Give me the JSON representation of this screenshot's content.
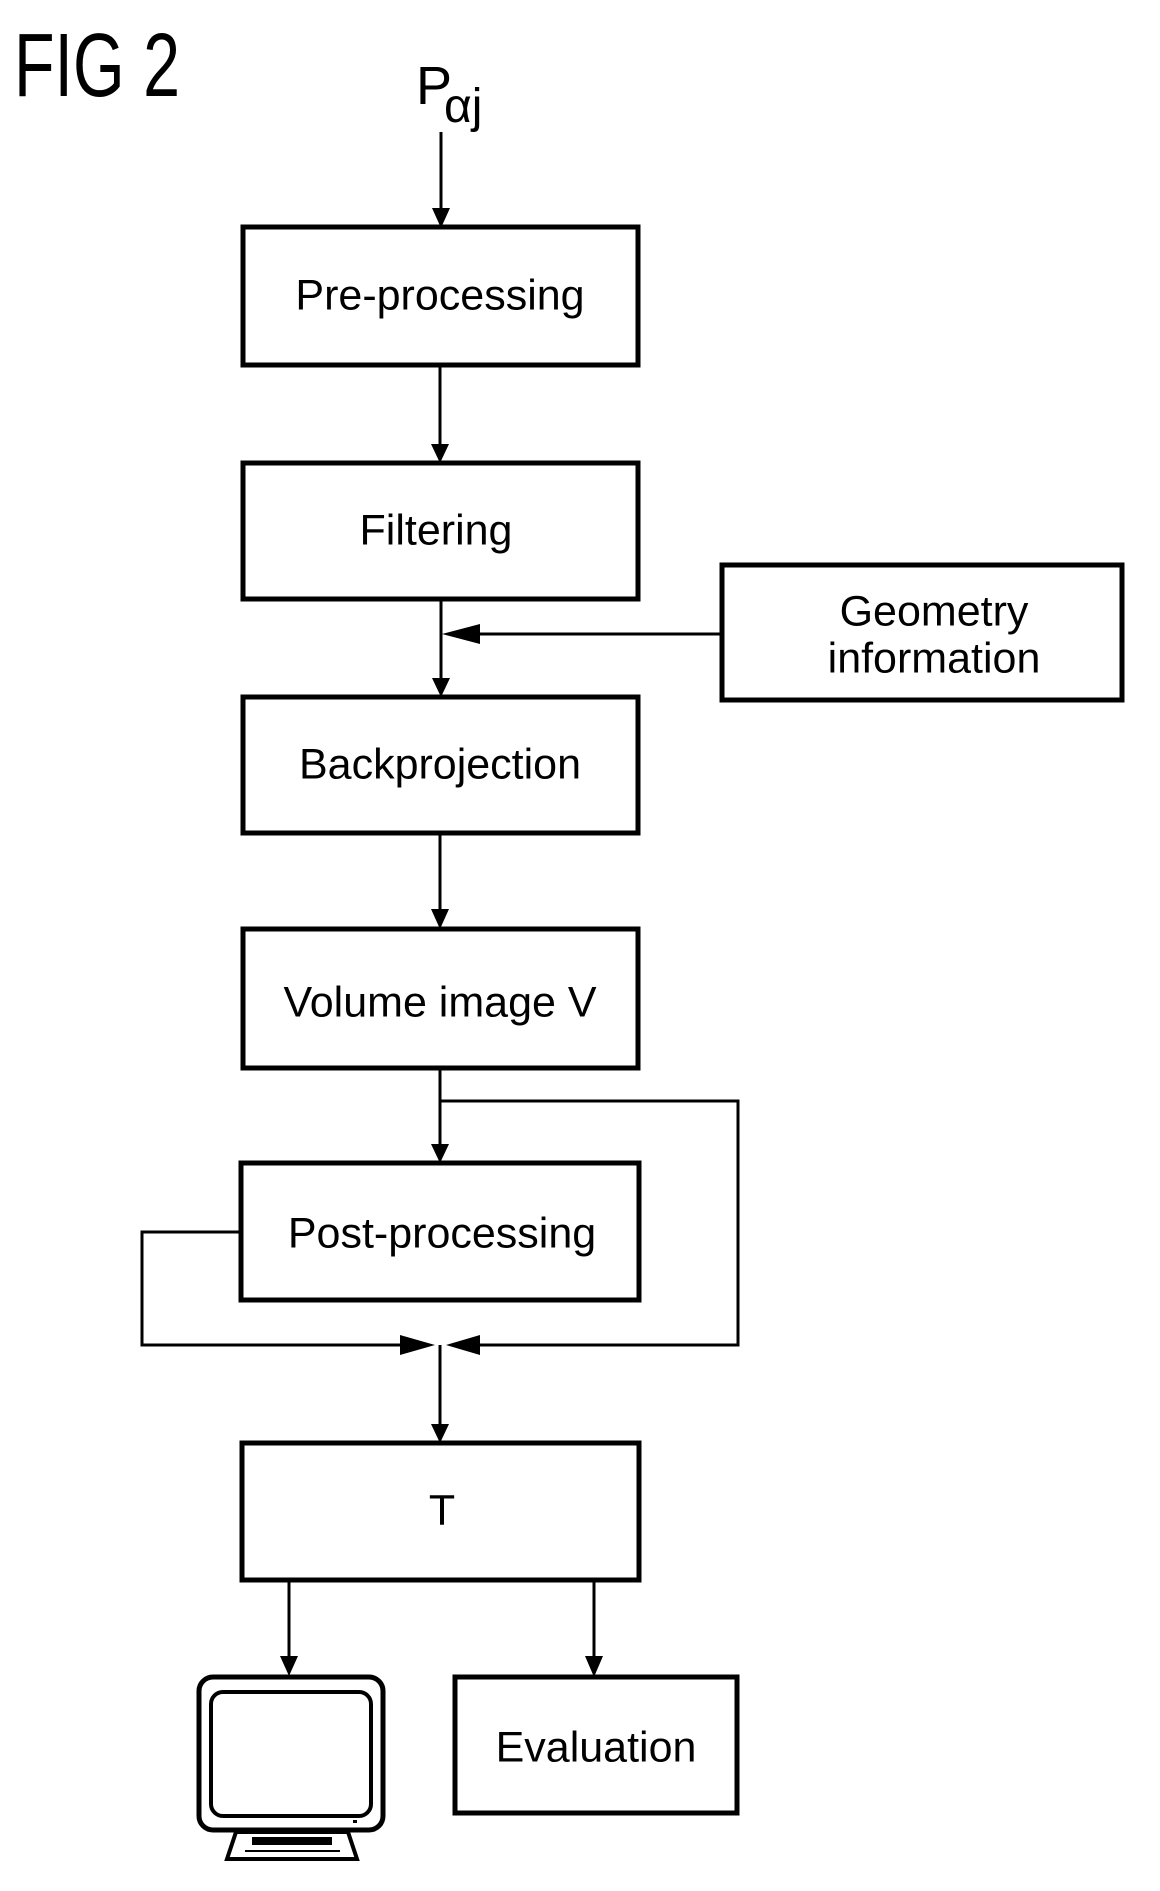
{
  "figure": {
    "title": "FIG 2",
    "input_symbol": {
      "base": "P",
      "subscript": "αj"
    }
  },
  "nodes": {
    "preprocessing": "Pre-processing",
    "filtering": "Filtering",
    "geometry_line1": "Geometry",
    "geometry_line2": "information",
    "backprojection": "Backprojection",
    "volume_image": "Volume image V",
    "postprocessing": "Post-processing",
    "t": "T",
    "evaluation": "Evaluation",
    "display": "monitor-icon"
  },
  "edges": [
    {
      "from": "Pαj",
      "to": "Pre-processing"
    },
    {
      "from": "Pre-processing",
      "to": "Filtering"
    },
    {
      "from": "Filtering",
      "to": "Backprojection"
    },
    {
      "from": "Geometry information",
      "to": "Filtering→Backprojection link"
    },
    {
      "from": "Backprojection",
      "to": "Volume image V"
    },
    {
      "from": "Volume image V",
      "to": "Post-processing"
    },
    {
      "from": "Volume image V",
      "to": "T",
      "via": "bypass loop (right)"
    },
    {
      "from": "Post-processing",
      "to": "T",
      "via": "loop (left)"
    },
    {
      "from": "T",
      "to": "Display monitor"
    },
    {
      "from": "T",
      "to": "Evaluation"
    }
  ]
}
